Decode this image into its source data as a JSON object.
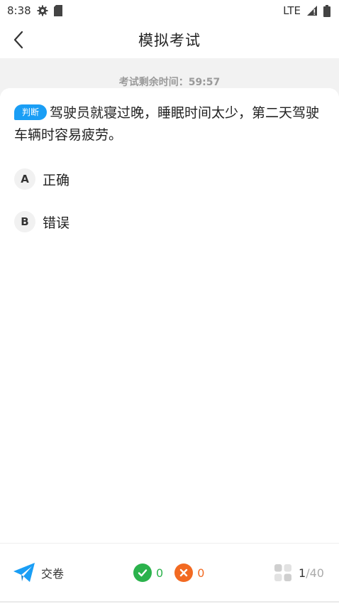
{
  "status_bar": {
    "time": "8:38",
    "network": "LTE",
    "icons": [
      "gear-icon",
      "sd-card-icon",
      "signal-icon",
      "battery-icon"
    ]
  },
  "header": {
    "title": "模拟考试",
    "back_icon": "chevron-left-icon"
  },
  "timer": {
    "text": "考试剩余时间：59:57"
  },
  "question": {
    "type_label": "判断",
    "text": "驾驶员就寝过晚，睡眠时间太少，第二天驾驶车辆时容易疲劳。",
    "options": [
      {
        "letter": "A",
        "text": "正确"
      },
      {
        "letter": "B",
        "text": "错误"
      }
    ]
  },
  "bottom_bar": {
    "submit_label": "交卷",
    "submit_icon": "paper-plane-icon",
    "correct_count": "0",
    "wrong_count": "0",
    "progress_current": "1",
    "progress_separator": "/",
    "progress_total": "40"
  },
  "colors": {
    "accent": "#1a9ef5",
    "correct": "#2bb24c",
    "wrong": "#f26a22"
  }
}
